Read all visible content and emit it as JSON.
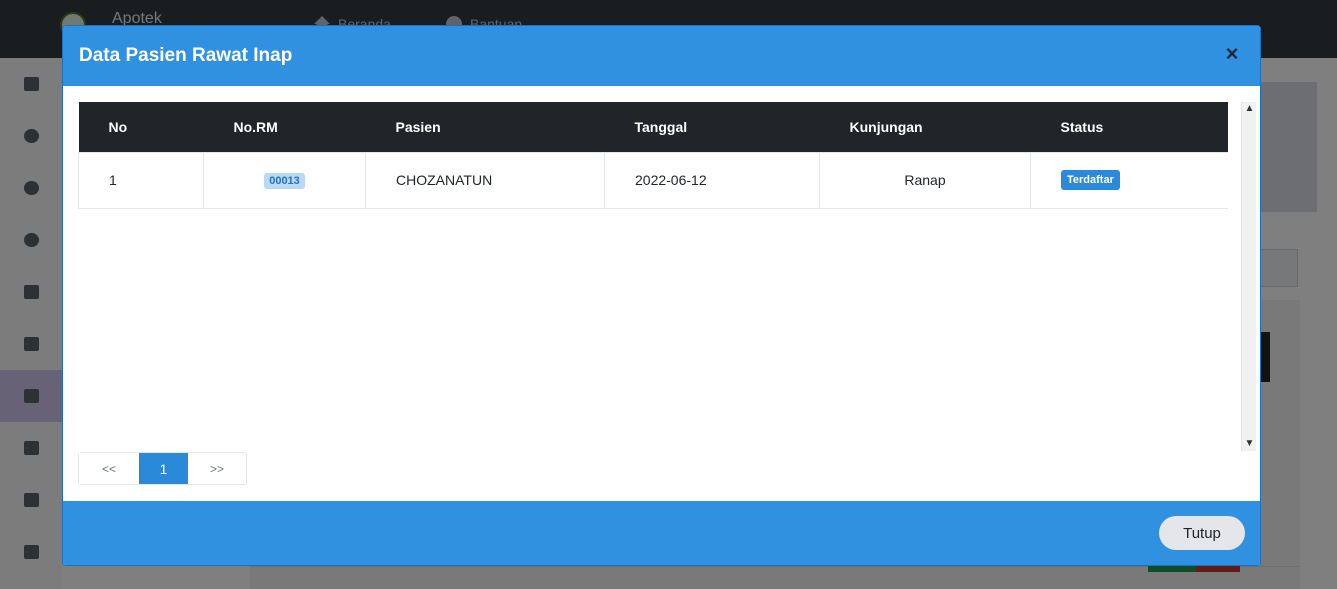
{
  "app": {
    "brand": "Apotek",
    "nav": [
      {
        "label": "Beranda",
        "icon": "home-icon"
      },
      {
        "label": "Bantuan",
        "icon": "help-icon"
      }
    ],
    "sidebar_icons": [
      "monitor-icon",
      "info-icon",
      "user-icon",
      "gear-icon",
      "id-card-icon",
      "house-medical-icon",
      "bed-icon",
      "contact-card-icon",
      "people-icon",
      "truck-icon"
    ]
  },
  "modal": {
    "title": "Data Pasien Rawat Inap",
    "close_symbol": "×",
    "table": {
      "headers": [
        "No",
        "No.RM",
        "Pasien",
        "Tanggal",
        "Kunjungan",
        "Status"
      ],
      "rows": [
        {
          "no": "1",
          "no_rm": "00013",
          "pasien": "CHOZANATUN",
          "tanggal": "2022-06-12",
          "kunjungan": "Ranap",
          "status": "Terdaftar"
        }
      ]
    },
    "pagination": {
      "prev": "<<",
      "current": "1",
      "next": ">>"
    },
    "footer": {
      "close_label": "Tutup"
    }
  },
  "colors": {
    "primary": "#3091e0",
    "header_dark": "#212529",
    "badge_status": "#2b89d9",
    "badge_rm": "#b9d8f3"
  }
}
